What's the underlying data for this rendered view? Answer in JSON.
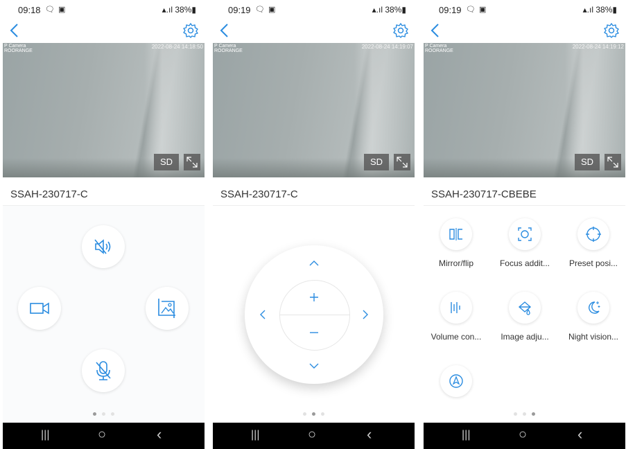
{
  "screens": [
    {
      "status": {
        "time": "09:18",
        "notif_icons": "🗨 ▣",
        "battery": "38%"
      },
      "video": {
        "cam_label": "P Camera",
        "cam_sub": "ROORANGE",
        "timestamp": "2022-08-24 14:18:50",
        "quality": "SD"
      },
      "device_name": "SSAH-230717-C",
      "controls": [
        {
          "name": "mute",
          "icon": "speaker-mute-icon"
        },
        {
          "name": "record",
          "icon": "video-camera-icon"
        },
        {
          "name": "screenshot",
          "icon": "image-icon"
        },
        {
          "name": "microphone",
          "icon": "microphone-off-icon"
        }
      ],
      "page_indicator": {
        "count": 3,
        "active": 0
      }
    },
    {
      "status": {
        "time": "09:19",
        "notif_icons": "🗨 ▣",
        "battery": "38%"
      },
      "video": {
        "cam_label": "P Camera",
        "cam_sub": "ROORANGE",
        "timestamp": "2022-08-24 14:19:07",
        "quality": "SD"
      },
      "device_name": "SSAH-230717-C",
      "ptz": {
        "up": "^",
        "down": "v",
        "left": "<",
        "right": ">",
        "zoom_in": "+",
        "zoom_out": "−"
      },
      "page_indicator": {
        "count": 3,
        "active": 1
      }
    },
    {
      "status": {
        "time": "09:19",
        "notif_icons": "🗨 ▣",
        "battery": "38%"
      },
      "video": {
        "cam_label": "P Camera",
        "cam_sub": "ROORANGE",
        "timestamp": "2022-08-24 14:19:12",
        "quality": "SD"
      },
      "device_name": "SSAH-230717-CBEBE",
      "features": [
        {
          "label": "Mirror/flip",
          "icon": "mirror-flip-icon"
        },
        {
          "label": "Focus addit...",
          "icon": "focus-icon"
        },
        {
          "label": "Preset posi...",
          "icon": "crosshair-icon"
        },
        {
          "label": "Volume con...",
          "icon": "volume-bars-icon"
        },
        {
          "label": "Image adju...",
          "icon": "image-adjust-icon"
        },
        {
          "label": "Night vision...",
          "icon": "night-moon-icon"
        },
        {
          "label": "",
          "icon": "navigation-pin-icon"
        }
      ],
      "page_indicator": {
        "count": 3,
        "active": 2
      }
    }
  ],
  "navbar": {
    "recents": "|||",
    "home": "○",
    "back": "‹"
  },
  "colors": {
    "accent": "#2a8ce0",
    "panel_bg": "#fafbfc"
  }
}
